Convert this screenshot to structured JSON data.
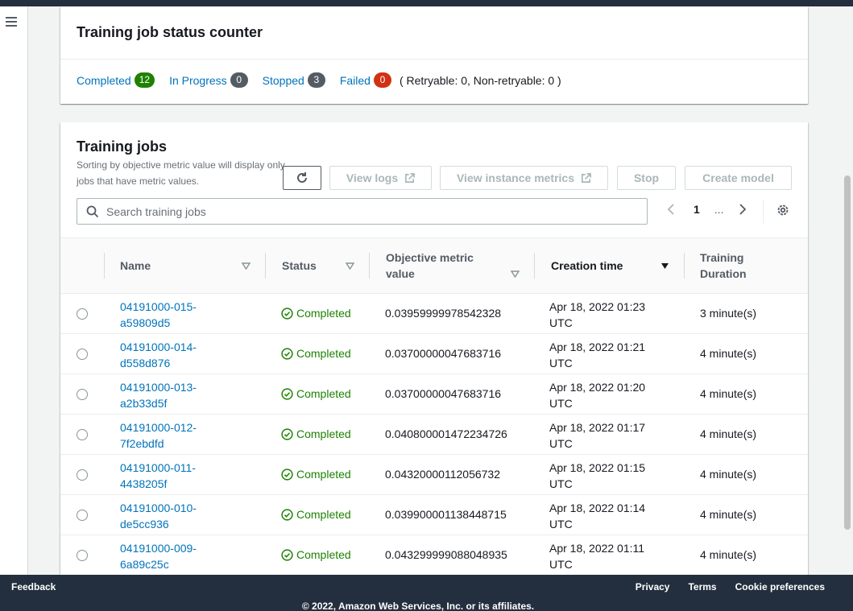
{
  "status_counter": {
    "title": "Training job status counter",
    "counters": [
      {
        "label": "Completed",
        "count": "12",
        "color": "#1d8102"
      },
      {
        "label": "In Progress",
        "count": "0",
        "color": "#545b64"
      },
      {
        "label": "Stopped",
        "count": "3",
        "color": "#545b64"
      },
      {
        "label": "Failed",
        "count": "0",
        "color": "#d13212"
      }
    ],
    "retry_text": "( Retryable: 0, Non-retryable: 0 )"
  },
  "jobs": {
    "title": "Training jobs",
    "description": "Sorting by objective metric value will display only jobs that have metric values.",
    "buttons": {
      "view_logs": "View logs",
      "view_instance_metrics": "View instance metrics",
      "stop": "Stop",
      "create_model": "Create model"
    },
    "search_placeholder": "Search training jobs",
    "pagination": {
      "current_page": "1",
      "ellipsis": "..."
    },
    "columns": {
      "name": "Name",
      "status": "Status",
      "objective": "Objective metric value",
      "creation": "Creation time",
      "duration": "Training Duration"
    },
    "rows": [
      {
        "name": "04191000-015-a59809d5",
        "status": "Completed",
        "metric": "0.03959999978542328",
        "created": "Apr 18, 2022 01:23 UTC",
        "duration": "3 minute(s)"
      },
      {
        "name": "04191000-014-d558d876",
        "status": "Completed",
        "metric": "0.03700000047683716",
        "created": "Apr 18, 2022 01:21 UTC",
        "duration": "4 minute(s)"
      },
      {
        "name": "04191000-013-a2b33d5f",
        "status": "Completed",
        "metric": "0.03700000047683716",
        "created": "Apr 18, 2022 01:20 UTC",
        "duration": "4 minute(s)"
      },
      {
        "name": "04191000-012-7f2ebdfd",
        "status": "Completed",
        "metric": "0.040800001472234726",
        "created": "Apr 18, 2022 01:17 UTC",
        "duration": "4 minute(s)"
      },
      {
        "name": "04191000-011-4438205f",
        "status": "Completed",
        "metric": "0.04320000112056732",
        "created": "Apr 18, 2022 01:15 UTC",
        "duration": "4 minute(s)"
      },
      {
        "name": "04191000-010-de5cc936",
        "status": "Completed",
        "metric": "0.039900001138448715",
        "created": "Apr 18, 2022 01:14 UTC",
        "duration": "4 minute(s)"
      },
      {
        "name": "04191000-009-6a89c25c",
        "status": "Completed",
        "metric": "0.043299999088048935",
        "created": "Apr 18, 2022 01:11 UTC",
        "duration": "4 minute(s)"
      }
    ]
  },
  "footer": {
    "feedback": "Feedback",
    "links": [
      "Privacy",
      "Terms",
      "Cookie preferences"
    ],
    "copyright": "© 2022, Amazon Web Services, Inc. or its affiliates."
  },
  "icons": {
    "menu": "hamburger-menu-icon",
    "refresh": "refresh-icon",
    "external": "external-link-icon",
    "search": "search-icon",
    "prev": "chevron-left-icon",
    "next": "chevron-right-icon",
    "settings": "gear-icon",
    "status": "check-circle-icon"
  }
}
